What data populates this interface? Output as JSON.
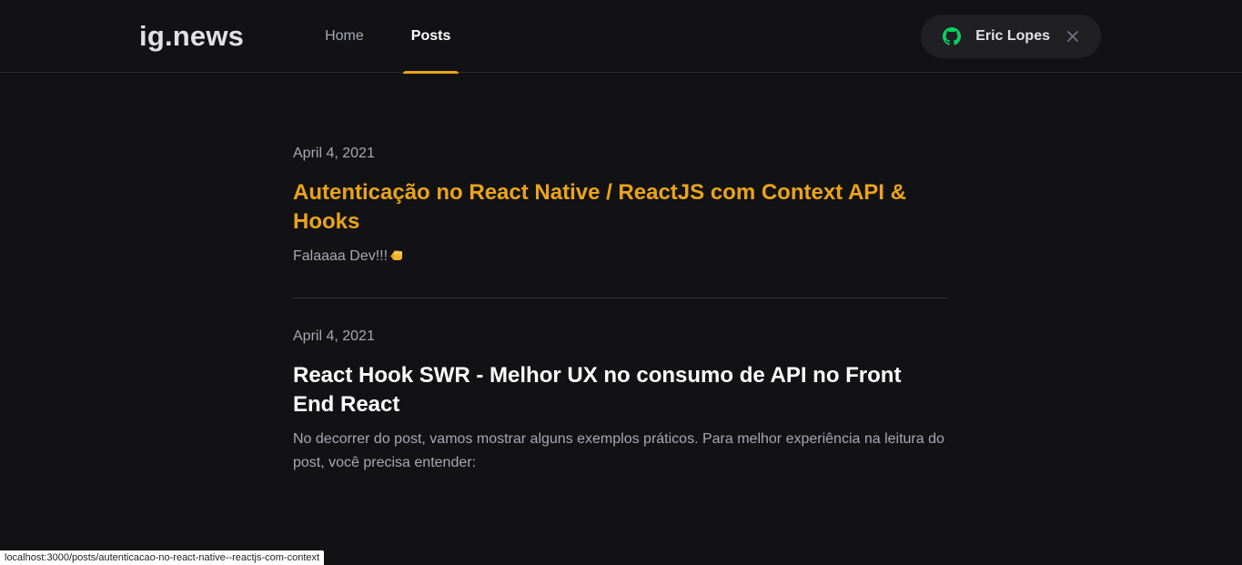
{
  "header": {
    "logo": "ig.news",
    "nav": [
      {
        "label": "Home",
        "active": false
      },
      {
        "label": "Posts",
        "active": true
      }
    ],
    "signin": {
      "user_name": "Eric Lopes",
      "icon": "github-icon",
      "close_icon": "close-icon"
    }
  },
  "posts": [
    {
      "date": "April 4, 2021",
      "title": "Autenticação no React Native / ReactJS com Context API & Hooks",
      "excerpt": "Falaaaa Dev!!!",
      "emoji": "oncoming-fist-emoji"
    },
    {
      "date": "April 4, 2021",
      "title": "React Hook SWR - Melhor UX no consumo de API no Front End React",
      "excerpt": "No decorrer do post, vamos mostrar alguns exemplos práticos. Para melhor experiência na leitura do post, você precisa entender:"
    }
  ],
  "statusbar": {
    "url": "localhost:3000/posts/autenticacao-no-react-native--reactjs-com-context"
  },
  "colors": {
    "background": "#121214",
    "accent": "#eba417",
    "github_green": "#04d361",
    "text_muted": "#a8a8b3"
  }
}
